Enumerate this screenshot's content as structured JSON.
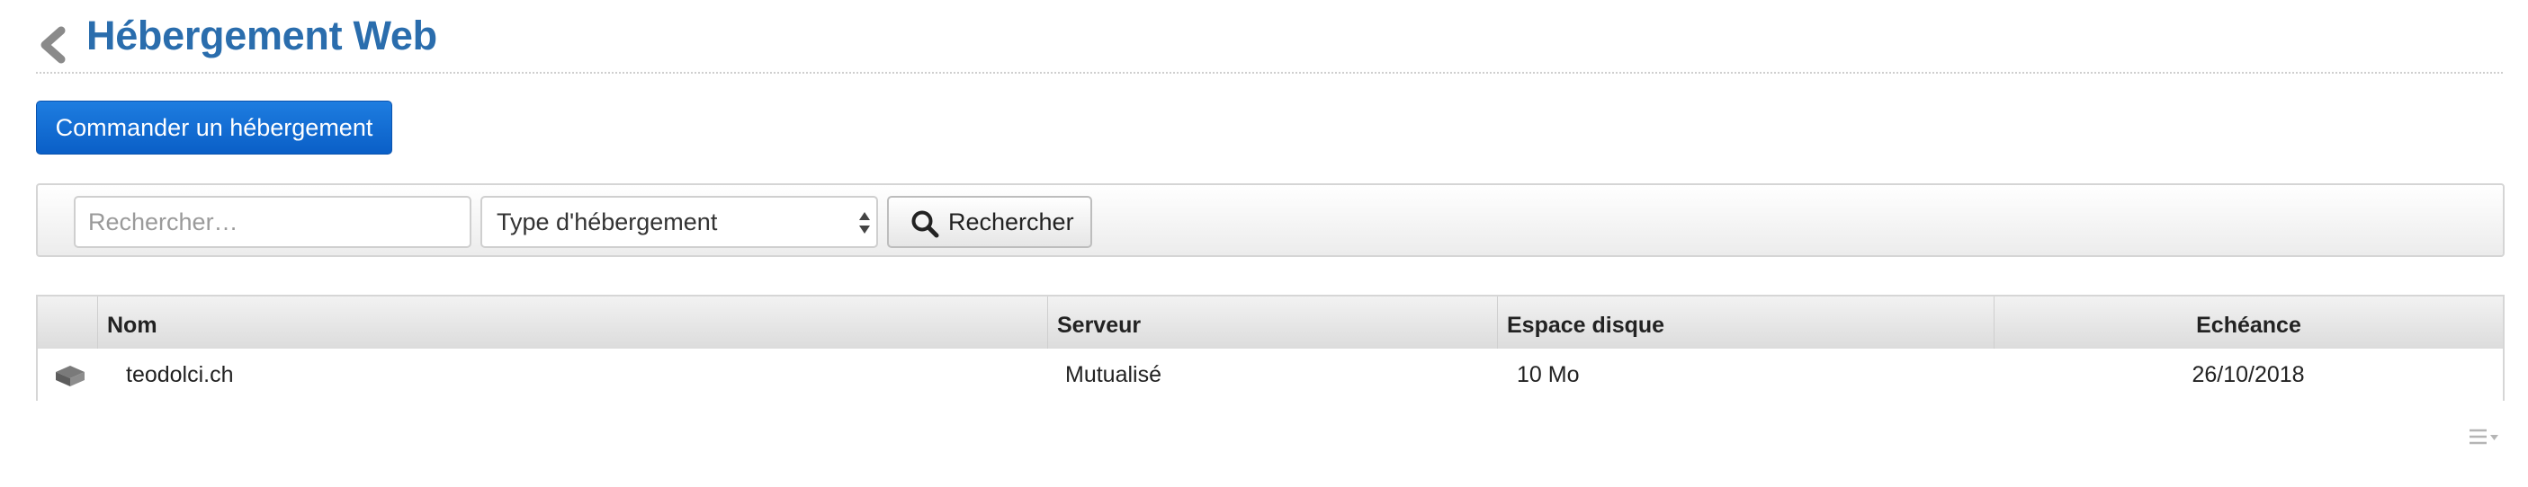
{
  "header": {
    "title": "Hébergement Web",
    "back_icon": "chevron-left-icon"
  },
  "actions": {
    "order_label": "Commander un hébergement"
  },
  "filters": {
    "search_placeholder": "Rechercher…",
    "type_select_value": "Type d'hébergement",
    "search_button_label": "Rechercher"
  },
  "table": {
    "columns": [
      "Nom",
      "Serveur",
      "Espace disque",
      "Echéance"
    ],
    "rows": [
      {
        "icon": "server-icon",
        "name": "teodolci.ch",
        "server": "Mutualisé",
        "disk": "10 Mo",
        "expiry": "26/10/2018"
      }
    ]
  },
  "colors": {
    "title": "#2a6dad",
    "primary_button": "#1a73d9"
  }
}
